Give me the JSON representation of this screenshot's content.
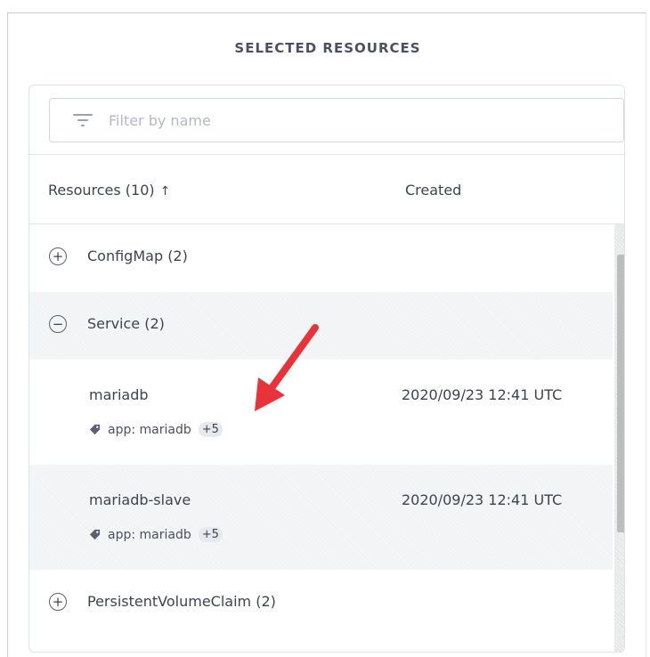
{
  "panel": {
    "title": "SELECTED RESOURCES"
  },
  "filter": {
    "placeholder": "Filter by name",
    "value": "",
    "icon": "filter-icon"
  },
  "table": {
    "columns": {
      "resources": "Resources (10)",
      "sort_indicator": "↑",
      "created": "Created"
    },
    "groups": [
      {
        "label": "ConfigMap (2)",
        "toggle": "+",
        "expanded": false
      },
      {
        "label": "Service (2)",
        "toggle": "−",
        "expanded": true
      },
      {
        "label": "PersistentVolumeClaim (2)",
        "toggle": "+",
        "expanded": false
      }
    ],
    "items": [
      {
        "name": "mariadb",
        "created": "2020/09/23 12:41 UTC",
        "label": "app: mariadb",
        "extra": "+5"
      },
      {
        "name": "mariadb-slave",
        "created": "2020/09/23 12:41 UTC",
        "label": "app: mariadb",
        "extra": "+5"
      }
    ]
  },
  "scrollbar": {
    "up": "▲",
    "down": "▼"
  },
  "colors": {
    "annotation_arrow": "#e8333a",
    "row_shade": "#f4f6f8",
    "text": "#3d4450"
  }
}
